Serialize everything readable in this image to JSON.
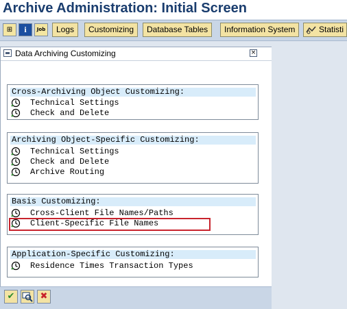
{
  "window": {
    "title": "Archive Administration: Initial Screen"
  },
  "toolbar": {
    "icons": [
      {
        "name": "hierarchy-icon",
        "glyph": "⊞"
      },
      {
        "name": "info-icon",
        "glyph": "i"
      },
      {
        "name": "job-icon",
        "glyph": "Job"
      }
    ],
    "buttons": [
      "Logs",
      "Customizing",
      "Database Tables",
      "Information System",
      "Statisti"
    ]
  },
  "dialog": {
    "title": "Data Archiving Customizing",
    "close_glyph": "×",
    "groups": [
      {
        "heading": "Cross-Archiving Object Customizing:",
        "items": [
          "Technical Settings",
          "Check and Delete"
        ]
      },
      {
        "heading": "Archiving Object-Specific Customizing:",
        "items": [
          "Technical Settings",
          "Check and Delete",
          "Archive Routing"
        ]
      },
      {
        "heading": "Basis Customizing:",
        "items": [
          "Cross-Client File Names/Paths",
          "Client-Specific File Names"
        ]
      },
      {
        "heading": "Application-Specific Customizing:",
        "items": [
          "Residence Times Transaction Types"
        ]
      }
    ],
    "footer": {
      "buttons": [
        {
          "name": "confirm-button",
          "glyph": "✔",
          "color": "#2a8a2a"
        },
        {
          "name": "find-button",
          "glyph": "🔍",
          "color": "#1a3d6e"
        },
        {
          "name": "cancel-button",
          "glyph": "✖",
          "color": "#c8232c"
        }
      ]
    }
  },
  "colors": {
    "title": "#1a3d6e",
    "group_heading_bg": "#d8ecfa",
    "highlight": "#c8232c",
    "button_bg": "#f3e3a3"
  }
}
